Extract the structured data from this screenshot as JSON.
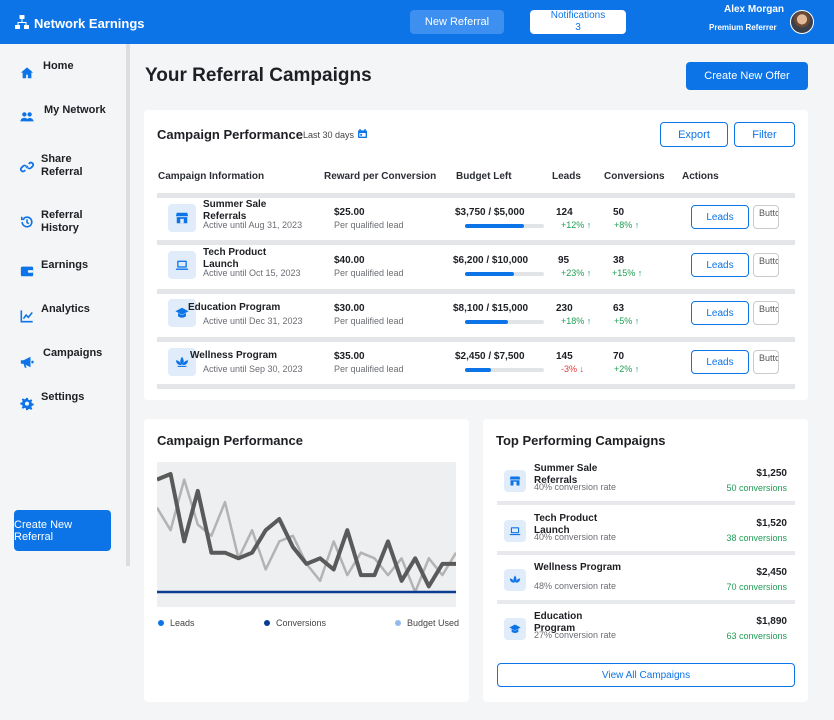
{
  "app": {
    "title": "Network Earnings"
  },
  "topbar": {
    "new_referral": "New Referral",
    "notifications_label": "Notifications",
    "notifications_count": "3",
    "user_name": "Alex Morgan",
    "user_role": "Premium Referrer"
  },
  "sidebar": {
    "items": [
      {
        "label": "Home",
        "icon": "home-icon"
      },
      {
        "label": "My Network",
        "icon": "users-icon"
      },
      {
        "label": "Share Referral",
        "icon": "link-icon"
      },
      {
        "label": "Referral History",
        "icon": "history-icon"
      },
      {
        "label": "Earnings",
        "icon": "wallet-icon"
      },
      {
        "label": "Analytics",
        "icon": "chart-icon"
      },
      {
        "label": "Campaigns",
        "icon": "megaphone-icon"
      },
      {
        "label": "Settings",
        "icon": "gear-icon"
      }
    ],
    "create_button": "Create New Referral"
  },
  "page": {
    "title": "Your Referral Campaigns",
    "create_offer": "Create New Offer"
  },
  "performance_table": {
    "title": "Campaign Performance",
    "range": "Last 30 days",
    "export": "Export",
    "filter": "Filter",
    "headers": [
      "Campaign Information",
      "Reward per Conversion",
      "Budget Left",
      "Leads",
      "Conversions",
      "Actions"
    ],
    "leads_button": "Leads",
    "more_button": "Button",
    "rows": [
      {
        "icon": "store-icon",
        "name": "Summer Sale Referrals",
        "active": "Active until Aug 31, 2023",
        "reward": "$25.00",
        "reward_sub": "Per qualified lead",
        "budget": "$3,750 / $5,000",
        "budget_fraction": 0.75,
        "leads": "124",
        "leads_trend": "+12%",
        "leads_dir": "up",
        "conversions": "50",
        "conv_trend": "+8%",
        "conv_dir": "up"
      },
      {
        "icon": "laptop-icon",
        "name": "Tech Product Launch",
        "active": "Active until Oct 15, 2023",
        "reward": "$40.00",
        "reward_sub": "Per qualified lead",
        "budget": "$6,200 / $10,000",
        "budget_fraction": 0.62,
        "leads": "95",
        "leads_trend": "+23%",
        "leads_dir": "up",
        "conversions": "38",
        "conv_trend": "+15%",
        "conv_dir": "up"
      },
      {
        "icon": "graduation-cap-icon",
        "name": "Education Program",
        "active": "Active until Dec 31, 2023",
        "reward": "$30.00",
        "reward_sub": "Per qualified lead",
        "budget": "$8,100 / $15,000",
        "budget_fraction": 0.54,
        "leads": "230",
        "leads_trend": "+18%",
        "leads_dir": "up",
        "conversions": "63",
        "conv_trend": "+5%",
        "conv_dir": "up"
      },
      {
        "icon": "lotus-icon",
        "name": "Wellness Program",
        "active": "Active until Sep 30, 2023",
        "reward": "$35.00",
        "reward_sub": "Per qualified lead",
        "budget": "$2,450 / $7,500",
        "budget_fraction": 0.33,
        "leads": "145",
        "leads_trend": "-3%",
        "leads_dir": "down",
        "conversions": "70",
        "conv_trend": "+2%",
        "conv_dir": "up"
      }
    ]
  },
  "chart_card": {
    "title": "Campaign Performance"
  },
  "chart_data": {
    "type": "line",
    "series": [
      {
        "name": "Leads",
        "color": "#5a5a5a",
        "values": [
          2.0,
          2.1,
          0.9,
          1.8,
          0.7,
          0.7,
          0.6,
          0.7,
          1.1,
          1.3,
          0.8,
          0.5,
          0.6,
          0.4,
          1.1,
          0.3,
          0.3,
          0.9,
          0.2,
          0.6,
          0.1,
          0.5,
          0.5
        ]
      },
      {
        "name": "Conversions",
        "color": "#0a3d8f",
        "values": [
          0,
          0,
          0,
          0,
          0,
          0,
          0,
          0,
          0,
          0,
          0,
          0,
          0,
          0,
          0,
          0,
          0,
          0,
          0,
          0,
          0,
          0,
          0
        ]
      },
      {
        "name": "Budget Used",
        "color": "#b3b3b3",
        "values": [
          1.5,
          1.1,
          2.0,
          1.2,
          1.0,
          1.6,
          0.6,
          1.1,
          0.4,
          0.9,
          1.0,
          0.5,
          0.2,
          0.9,
          0.3,
          0.7,
          0.6,
          0.3,
          0.6,
          0.0,
          0.6,
          0.3,
          0.7
        ]
      }
    ],
    "legend": [
      "Leads",
      "Conversions",
      "Budget Used"
    ],
    "legend_colors": [
      "#0d74e7",
      "#0a3d8f",
      "#8fbcec"
    ],
    "grid": false
  },
  "top_campaigns": {
    "title": "Top Performing Campaigns",
    "items": [
      {
        "icon": "store-icon",
        "name": "Summer Sale Referrals",
        "rate": "40% conversion rate",
        "amount": "$1,250",
        "conversions": "50 conversions"
      },
      {
        "icon": "laptop-icon",
        "name": "Tech Product Launch",
        "rate": "40% conversion rate",
        "amount": "$1,520",
        "conversions": "38 conversions"
      },
      {
        "icon": "lotus-icon",
        "name": "Wellness Program",
        "rate": "48% conversion rate",
        "amount": "$2,450",
        "conversions": "70 conversions"
      },
      {
        "icon": "graduation-cap-icon",
        "name": "Education Program",
        "rate": "27% conversion rate",
        "amount": "$1,890",
        "conversions": "63 conversions"
      }
    ],
    "view_all": "View All Campaigns"
  }
}
